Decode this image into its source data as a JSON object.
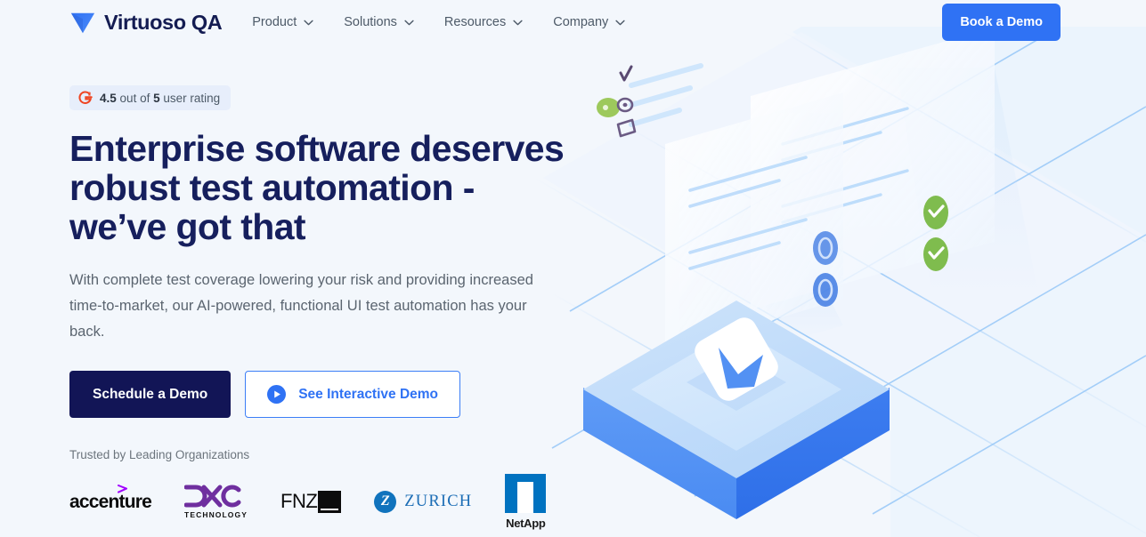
{
  "theme": {
    "page_background": "#f3f7fc",
    "brand_blue": "#2f72f4",
    "navy": "#161f5d",
    "muted_text": "#5b6570"
  },
  "header": {
    "brand": {
      "logo_icon": "virtuoso-v-logo",
      "name": "Virtuoso QA"
    },
    "nav": [
      {
        "label": "Product",
        "icon": "chevron-down-icon"
      },
      {
        "label": "Solutions",
        "icon": "chevron-down-icon"
      },
      {
        "label": "Resources",
        "icon": "chevron-down-icon"
      },
      {
        "label": "Company",
        "icon": "chevron-down-icon"
      }
    ],
    "cta": {
      "label": "Book a Demo",
      "color": "#2f72f4"
    }
  },
  "hero": {
    "rating_badge": {
      "icon": "g2-logo-icon",
      "score": "4.5",
      "middle_text": "out of",
      "max": "5",
      "suffix_text": "user rating",
      "background": "#e7eefb"
    },
    "headline": "Enterprise software deserves robust test automation - we’ve got that",
    "subhead": "With complete test coverage lowering your risk and providing increased time-to-market, our AI-powered, functional UI test automation has your back.",
    "primary_button": {
      "label": "Schedule a Demo",
      "color": "#121556"
    },
    "secondary_button": {
      "label": "See Interactive Demo",
      "icon": "play-circle-icon",
      "color": "#2f72f4"
    },
    "trusted_label": "Trusted by Leading Organizations",
    "logos": [
      {
        "name": "accenture",
        "text": "accenture",
        "accent": "#a100ff"
      },
      {
        "name": "dxc-technology",
        "text": "DXC",
        "sub_text": "TECHNOLOGY",
        "accent": "#6f2f9f"
      },
      {
        "name": "fnz",
        "text": "FNZ",
        "accent": "#0c0c0c"
      },
      {
        "name": "zurich",
        "text": "ZURICH",
        "mark": "Z",
        "accent": "#1a6cb5"
      },
      {
        "name": "netapp",
        "text": "NetApp",
        "accent": "#0072c0"
      }
    ]
  },
  "illustration": {
    "name": "isometric-platform-illustration",
    "elements": [
      "isometric-grid-background",
      "floating-card-back",
      "floating-card-front",
      "blue-circle-icon",
      "green-check-badge",
      "virtuoso-v-tile",
      "isometric-platform-slab",
      "checklist-icons"
    ]
  }
}
